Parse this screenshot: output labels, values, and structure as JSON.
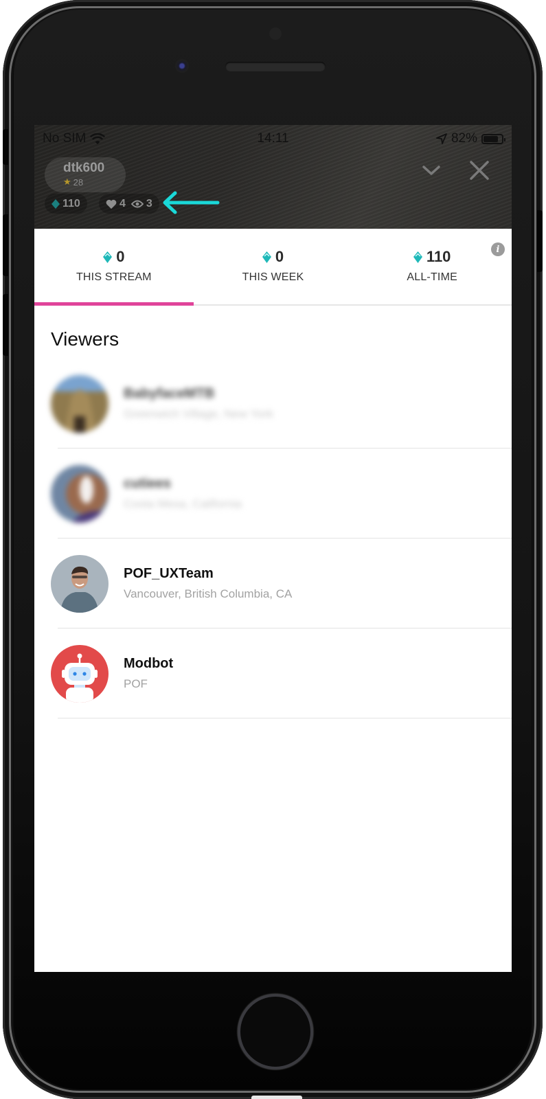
{
  "status_bar": {
    "carrier": "No SIM",
    "time": "14:11",
    "battery_percent_label": "82%",
    "battery_level": 0.82
  },
  "stream_header": {
    "host": {
      "username": "dtk600",
      "star_count": "28"
    },
    "gems": "110",
    "likes": "4",
    "viewers": "3"
  },
  "colors": {
    "accent_pink": "#e0449a",
    "gem_teal": "#1fb8b8",
    "annotation_cyan": "#1ad8d8"
  },
  "tabs": [
    {
      "count": "0",
      "label": "THIS STREAM",
      "active": true
    },
    {
      "count": "0",
      "label": "THIS WEEK",
      "active": false
    },
    {
      "count": "110",
      "label": "ALL-TIME",
      "active": false
    }
  ],
  "viewers_section": {
    "title": "Viewers",
    "items": [
      {
        "name": "BabyfaceMTB",
        "location": "Greenwich Village, New York",
        "blurred": true
      },
      {
        "name": "cutiees",
        "location": "Costa Mesa, California",
        "blurred": true
      },
      {
        "name": "POF_UXTeam",
        "location": "Vancouver, British Columbia, CA",
        "blurred": false
      },
      {
        "name": "Modbot",
        "location": "POF",
        "blurred": false
      }
    ]
  }
}
